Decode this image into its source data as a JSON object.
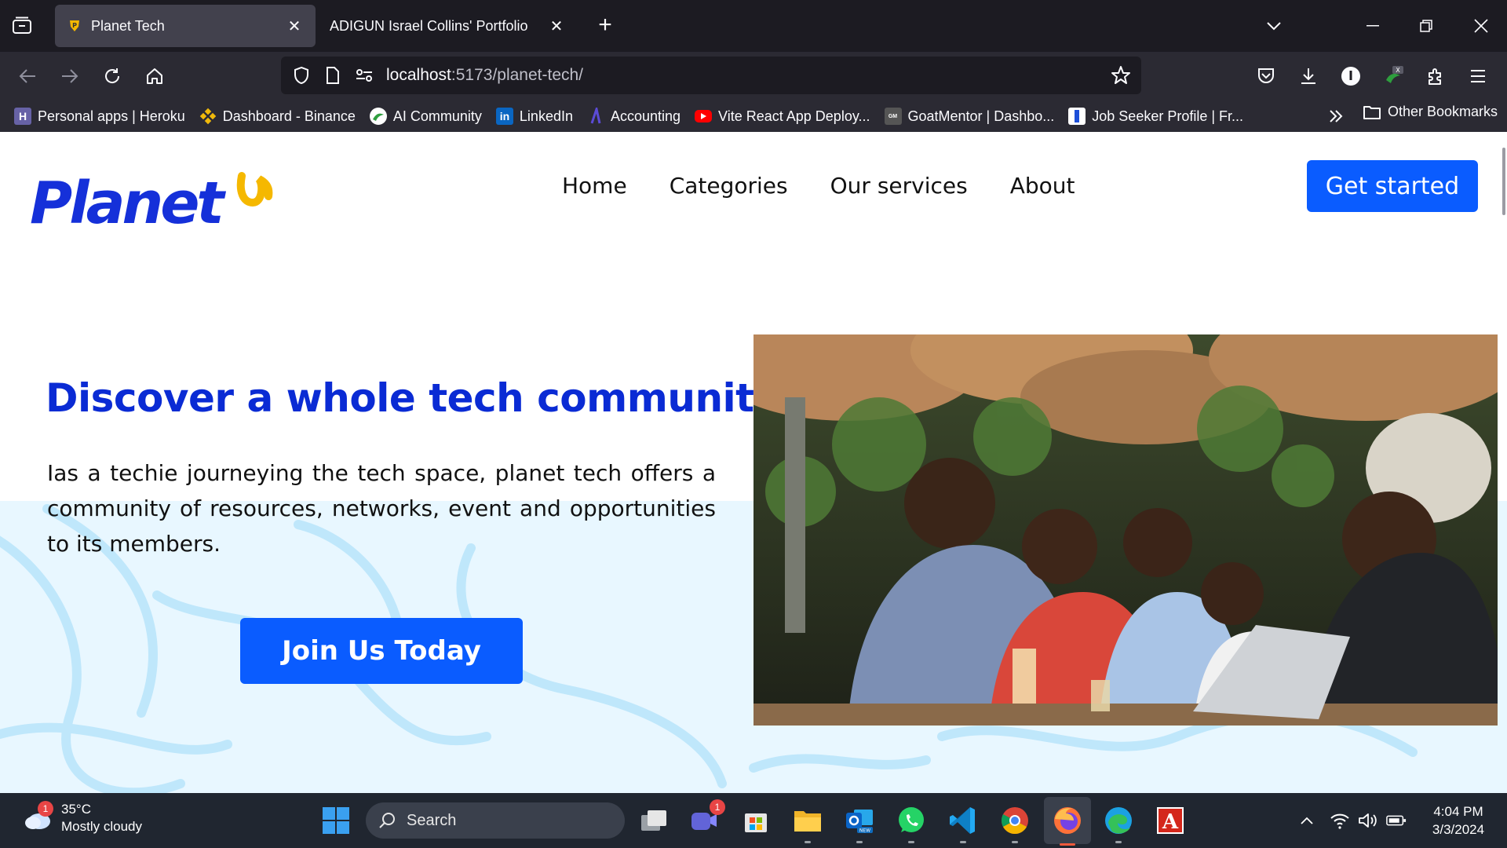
{
  "browser": {
    "tabs": [
      {
        "title": "Planet Tech",
        "active": true
      },
      {
        "title": "ADIGUN Israel Collins' Portfolio",
        "active": false
      }
    ],
    "url": {
      "host": "localhost",
      "path": ":5173/planet-tech/"
    },
    "bookmarks": [
      {
        "label": "Personal apps | Heroku",
        "icon": "heroku-icon",
        "color": "#6762a6"
      },
      {
        "label": "Dashboard - Binance",
        "icon": "binance-icon",
        "color": "#f0b90b"
      },
      {
        "label": "AI Community",
        "icon": "ai-community-icon",
        "color": "#2e9e3e"
      },
      {
        "label": "LinkedIn",
        "icon": "linkedin-icon",
        "color": "#0a66c2"
      },
      {
        "label": "Accounting",
        "icon": "accounting-icon",
        "color": "#5b4bd6"
      },
      {
        "label": "Vite React App Deploy...",
        "icon": "youtube-icon",
        "color": "#ff0000"
      },
      {
        "label": "GoatMentor | Dashbo...",
        "icon": "goatmentor-icon",
        "color": "#555555"
      },
      {
        "label": "Job Seeker Profile | Fr...",
        "icon": "job-seeker-icon",
        "color": "#1d4fd8"
      }
    ],
    "other_bookmarks": "Other Bookmarks"
  },
  "site": {
    "logo_text": "Planet",
    "nav": [
      "Home",
      "Categories",
      "Our services",
      "About"
    ],
    "cta": "Get started",
    "hero_title": "Discover a whole tech community",
    "hero_description": "Ias a techie journeying the tech space, planet tech offers a community of resources, networks, event and opportunities to its members.",
    "join_button": "Join Us Today",
    "colors": {
      "primary": "#0a5cff",
      "heading": "#0a2bd4",
      "accent": "#f5b800",
      "light_bg": "#e8f7ff"
    }
  },
  "taskbar": {
    "weather": {
      "temp": "35°C",
      "condition": "Mostly cloudy",
      "badge": "1"
    },
    "search_placeholder": "Search",
    "teams_badge": "1",
    "time": "4:04 PM",
    "date": "3/3/2024"
  }
}
